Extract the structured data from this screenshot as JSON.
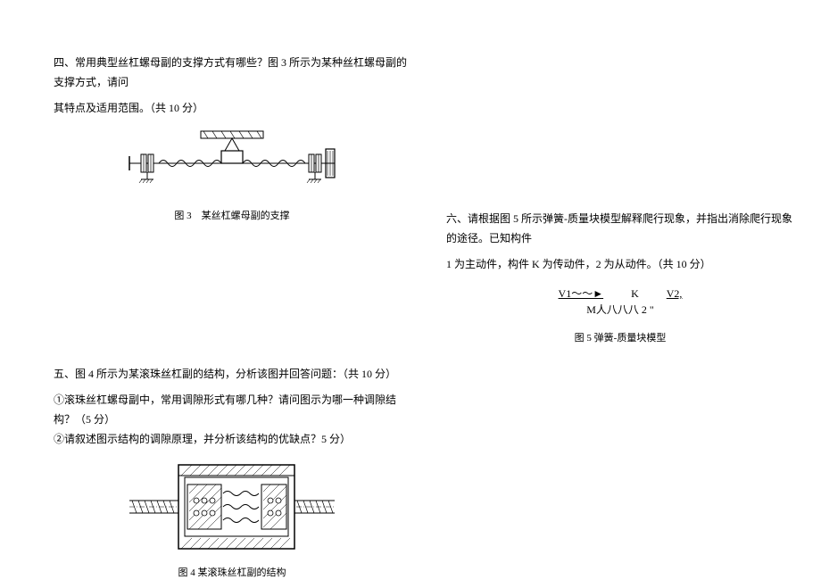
{
  "q4": {
    "text_line1": "四、常用典型丝杠螺母副的支撑方式有哪些？图 3 所示为某种丝杠螺母副的支撑方式，请问",
    "text_line2": "其特点及适用范围。（共 10 分）",
    "caption": "图 3　某丝杠螺母副的支撑"
  },
  "q5": {
    "text": "五、图 4 所示为某滚珠丝杠副的结构，分析该图并回答问题：（共 10 分）",
    "sub1": "①滚珠丝杠螺母副中，常用调隙形式有哪几种？请问图示为哪一种调隙结构？（5 分）",
    "sub2": "②请叙述图示结构的调隙原理，并分析该结构的优缺点？5 分）",
    "caption": "图 4 某滚珠丝杠副的结构"
  },
  "q6": {
    "text_line1": "六、请根据图 5 所示弹簧-质量块模型解释爬行现象，并指出消除爬行现象的途径。已知构件",
    "text_line2": "1 为主动件，构件 K 为传动件，2 为从动件。（共 10 分）",
    "model_v1": "V1～～►",
    "model_k": "K",
    "model_v2": "V2,",
    "model_line2": "M人八八八 2 \"",
    "caption": "图 5 弹簧-质量块模型"
  }
}
